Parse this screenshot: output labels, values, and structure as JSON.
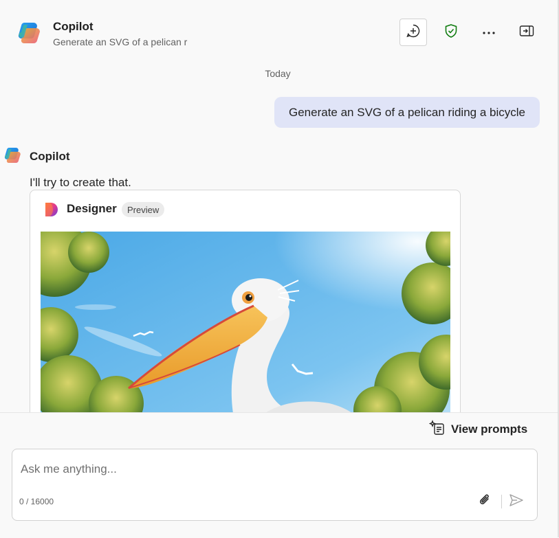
{
  "header": {
    "title": "Copilot",
    "subtitle": "Generate an SVG of a pelican r",
    "actions": [
      {
        "icon": "new-chat-icon"
      },
      {
        "icon": "shield-check-icon"
      },
      {
        "icon": "more-icon"
      },
      {
        "icon": "sidebar-toggle-icon"
      }
    ]
  },
  "conversation": {
    "date_label": "Today",
    "user_message": "Generate an SVG of a pelican riding a bicycle",
    "bot": {
      "name": "Copilot",
      "text": "I'll try to create that."
    },
    "designer_card": {
      "title": "Designer",
      "badge": "Preview",
      "image_icon": "generated-pelican-image"
    }
  },
  "composer": {
    "view_prompts_label": "View prompts",
    "placeholder": "Ask me anything...",
    "value": "",
    "char_count": "0 / 16000"
  },
  "colors": {
    "user_bubble": "#e0e4f7",
    "shield_green": "#107c10",
    "background": "#f9f9f9"
  }
}
